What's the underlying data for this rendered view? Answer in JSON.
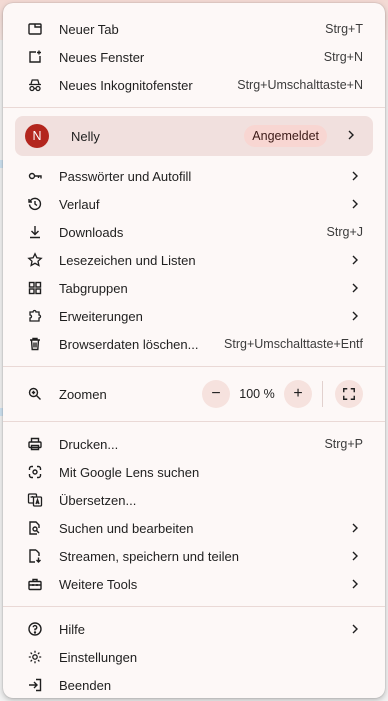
{
  "group1": [
    {
      "icon": "new-tab-icon",
      "label": "Neuer Tab",
      "shortcut": "Strg+T"
    },
    {
      "icon": "new-window-icon",
      "label": "Neues Fenster",
      "shortcut": "Strg+N"
    },
    {
      "icon": "incognito-icon",
      "label": "Neues Inkognitofenster",
      "shortcut": "Strg+Umschalttaste+N"
    }
  ],
  "profile": {
    "initial": "N",
    "name": "Nelly",
    "status": "Angemeldet"
  },
  "group2": [
    {
      "icon": "key-icon",
      "label": "Passwörter und Autofill"
    },
    {
      "icon": "history-icon",
      "label": "Verlauf"
    },
    {
      "icon": "download-icon",
      "label": "Downloads",
      "shortcut": "Strg+J"
    },
    {
      "icon": "star-icon",
      "label": "Lesezeichen und Listen"
    },
    {
      "icon": "tab-groups-icon",
      "label": "Tabgruppen"
    },
    {
      "icon": "extension-icon",
      "label": "Erweiterungen"
    },
    {
      "icon": "trash-icon",
      "label": "Browserdaten löschen...",
      "shortcut": "Strg+Umschalttaste+Entf"
    }
  ],
  "zoom": {
    "icon": "zoom-icon",
    "label": "Zoomen",
    "minus": "−",
    "value": "100 %",
    "plus": "+"
  },
  "group3": [
    {
      "icon": "print-icon",
      "label": "Drucken...",
      "shortcut": "Strg+P"
    },
    {
      "icon": "google-lens-icon",
      "label": "Mit Google Lens suchen"
    },
    {
      "icon": "translate-icon",
      "label": "Übersetzen..."
    },
    {
      "icon": "find-edit-icon",
      "label": "Suchen und bearbeiten"
    },
    {
      "icon": "cast-save-share-icon",
      "label": "Streamen, speichern und teilen"
    },
    {
      "icon": "toolbox-icon",
      "label": "Weitere Tools"
    }
  ],
  "group4": [
    {
      "icon": "help-icon",
      "label": "Hilfe"
    },
    {
      "icon": "settings-gear-icon",
      "label": "Einstellungen"
    },
    {
      "icon": "exit-icon",
      "label": "Beenden"
    }
  ]
}
